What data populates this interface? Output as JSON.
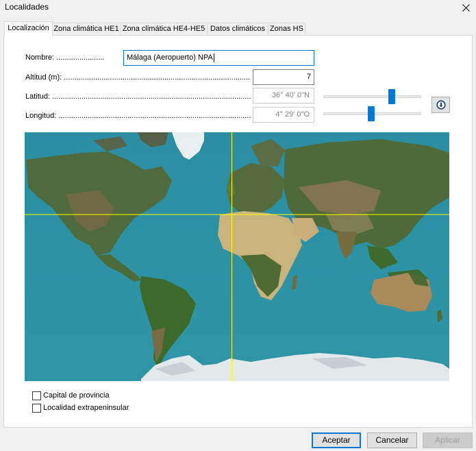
{
  "window": {
    "title": "Localidades"
  },
  "tabs": [
    {
      "label": "Localización"
    },
    {
      "label": "Zona climática HE1"
    },
    {
      "label": "Zona climática HE4-HE5"
    },
    {
      "label": "Datos climáticos"
    },
    {
      "label": "Zonas HS"
    }
  ],
  "form": {
    "nombre": {
      "label": "Nombre: .......................",
      "value": "Málaga (Aeropuerto) NPA"
    },
    "altitud": {
      "label": "Altitud (m): ............................................................................................",
      "value": "7"
    },
    "latitud": {
      "label": "Latitud: .......................................................................................................",
      "value": "36° 40'  0\"N",
      "slider_fraction": 0.7
    },
    "longitud": {
      "label": "Longitud: .....................................................................................................",
      "value": "4° 29'  0\"O",
      "slider_fraction": 0.49
    }
  },
  "locate_button": {
    "icon": "compass-icon"
  },
  "map": {
    "crosshair_color": "#ffff00",
    "ocean_color": "#2f93a4"
  },
  "checkboxes": [
    {
      "label": "Capital de provincia",
      "checked": false
    },
    {
      "label": "Localidad extrapeninsular",
      "checked": false
    }
  ],
  "buttons": {
    "accept": "Aceptar",
    "cancel": "Cancelar",
    "apply": "Aplicar"
  },
  "colors": {
    "accent": "#0078d7",
    "disabled_text": "#838383"
  }
}
